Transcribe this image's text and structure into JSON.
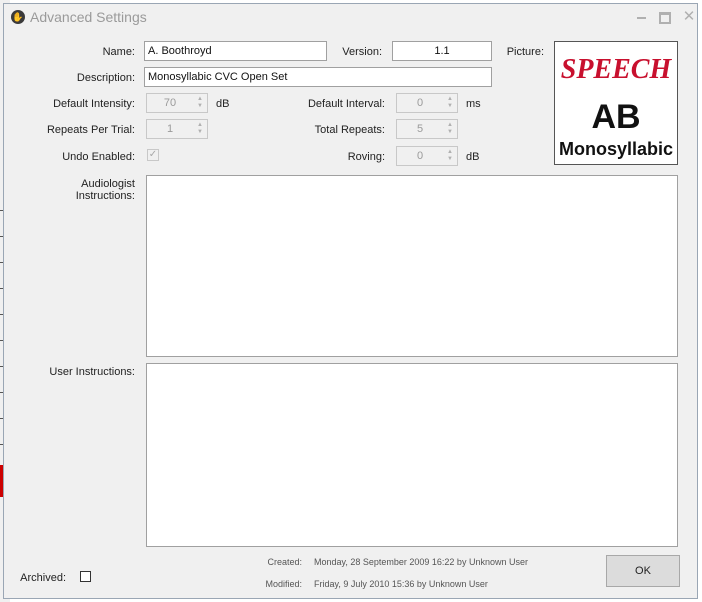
{
  "window": {
    "title": "Advanced Settings",
    "controls": {
      "minimize": "minimize",
      "maximize": "maximize",
      "close": "✕"
    }
  },
  "form": {
    "name": {
      "label": "Name:",
      "value": "A. Boothroyd"
    },
    "version": {
      "label": "Version:",
      "value": "1.1"
    },
    "picture_label": "Picture:",
    "description": {
      "label": "Description:",
      "value": "Monosyllabic CVC Open Set"
    },
    "default_intensity": {
      "label": "Default Intensity:",
      "value": "70",
      "unit": "dB"
    },
    "default_interval": {
      "label": "Default Interval:",
      "value": "0",
      "unit": "ms"
    },
    "repeats_per_trial": {
      "label": "Repeats Per Trial:",
      "value": "1"
    },
    "total_repeats": {
      "label": "Total Repeats:",
      "value": "5"
    },
    "undo_enabled": {
      "label": "Undo Enabled:",
      "checked": true
    },
    "roving": {
      "label": "Roving:",
      "value": "0",
      "unit": "dB"
    },
    "audiologist_instructions": {
      "label_line1": "Audiologist",
      "label_line2": "Instructions:",
      "value": ""
    },
    "user_instructions": {
      "label": "User Instructions:",
      "value": ""
    },
    "archived": {
      "label": "Archived:",
      "checked": false
    }
  },
  "picture": {
    "brand": "SPEECH",
    "code": "AB",
    "subtitle": "Monosyllabic"
  },
  "meta": {
    "created_label": "Created:",
    "created_value": "Monday, 28 September 2009 16:22 by Unknown User",
    "modified_label": "Modified:",
    "modified_value": "Friday, 9 July 2010 15:36 by Unknown User"
  },
  "buttons": {
    "ok": "OK"
  },
  "colors": {
    "brand_red": "#c8102e",
    "window_bg": "#f0f0f0"
  }
}
